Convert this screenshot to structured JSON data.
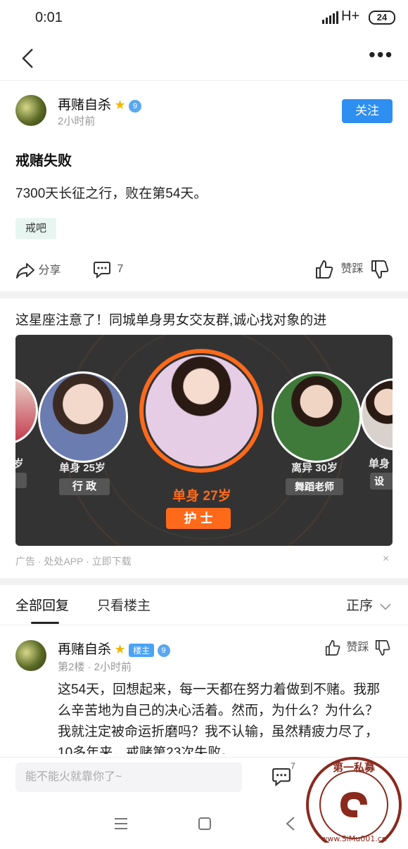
{
  "status": {
    "time": "0:01",
    "network": "H+",
    "battery": "24"
  },
  "post": {
    "author": "再赌自杀",
    "vip_level": "9",
    "time": "2小时前",
    "follow_label": "关注",
    "title": "戒赌失败",
    "body": "7300天长征之行，败在第54天。",
    "tag": "戒吧",
    "share_label": "分享",
    "comment_count": "7",
    "vote_label": "赞踩"
  },
  "ad": {
    "title": "这星座注意了！同城单身男女交友群,诚心找对象的进",
    "footer": "广告 · 处处APP ·  立即下载",
    "close": "×",
    "cards": [
      {
        "status": "岁",
        "job": ""
      },
      {
        "status": "单身 25岁",
        "job": "行 政"
      },
      {
        "status": "单身 27岁",
        "job": "护 士"
      },
      {
        "status": "离异 30岁",
        "job": "舞蹈老师"
      },
      {
        "status": "单身",
        "job": "设"
      }
    ]
  },
  "replies": {
    "tab_all": "全部回复",
    "tab_op": "只看楼主",
    "sort": "正序",
    "first": {
      "author": "再赌自杀",
      "badge": "楼主",
      "vip_level": "9",
      "floor_time": "第2楼 · 2小时前",
      "vote_label": "赞踩",
      "text": "这54天，回想起来，每一天都在努力着做到不赌。我那么辛苦地为自己的决心活着。然而，为什么？为什么？我就注定被命运折磨吗？我不认输，虽然精疲力尽了，10多年来，戒赌第23次失败。"
    }
  },
  "bottom": {
    "placeholder": "能不能火就靠你了~",
    "comment_count": "7"
  },
  "watermark": {
    "text": "第一私募",
    "url": "www.SiMu001.cn"
  }
}
